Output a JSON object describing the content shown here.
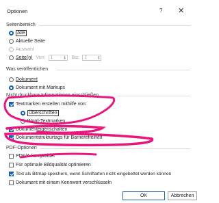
{
  "dialog": {
    "title": "Optionen",
    "help": "?",
    "close": "✕"
  },
  "range": {
    "heading": "Seitenbereich",
    "all": "Alle",
    "current": "Aktuelle Seite",
    "selection": "Auswahl",
    "pages": "Seite(n)",
    "from_label": "Von:",
    "from_value": "1",
    "to_label": "Bis:",
    "to_value": "1"
  },
  "publish": {
    "heading": "Was veröffentlichen",
    "document": "Dokument",
    "document_markup": "Dokument mit Markups"
  },
  "nonprint": {
    "heading": "Nicht druckbare Informationen einschließen",
    "bookmarks": "Textmarken erstellen mithilfe von:",
    "headings": "Überschriften",
    "word_bookmarks": "Word-Textmarken",
    "properties": "Dokumenteigenschaften",
    "structure_tags": "Dokumentstrukturtags für Barrierefreiheit"
  },
  "pdf": {
    "heading": "PDF-Optionen",
    "pdfa": "PDF/A-kompatibel",
    "optimize": "Für optimale Bildqualität optimieren",
    "bitmap": "Text als Bitmap speichern, wenn Schriftarten nicht eingebettet werden können",
    "encrypt": "Dokument mit einem Kennwort verschlüsseln"
  },
  "buttons": {
    "ok": "OK",
    "cancel": "Abbrechen"
  },
  "colors": {
    "accent": "#1a5fb4",
    "annotation": "#e8177d"
  }
}
